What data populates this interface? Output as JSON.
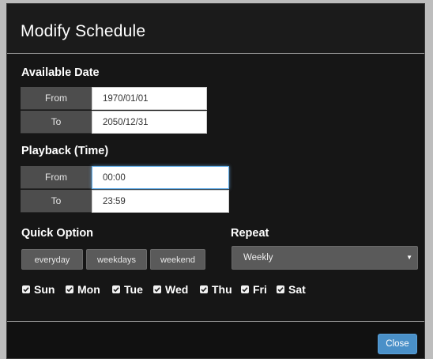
{
  "dialog": {
    "title": "Modify Schedule"
  },
  "available_date": {
    "heading": "Available Date",
    "from_label": "From",
    "from_value": "1970/01/01",
    "to_label": "To",
    "to_value": "2050/12/31"
  },
  "playback_time": {
    "heading": "Playback (Time)",
    "from_label": "From",
    "from_value": "00:00",
    "to_label": "To",
    "to_value": "23:59"
  },
  "quick_option": {
    "heading": "Quick Option",
    "buttons": [
      "everyday",
      "weekdays",
      "weekend"
    ]
  },
  "repeat": {
    "heading": "Repeat",
    "selected": "Weekly",
    "arrow": "▼"
  },
  "days": [
    {
      "label": "Sun",
      "checked": true
    },
    {
      "label": "Mon",
      "checked": true
    },
    {
      "label": "Tue",
      "checked": true
    },
    {
      "label": "Wed",
      "checked": true
    },
    {
      "label": "Thu",
      "checked": true
    },
    {
      "label": "Fri",
      "checked": true
    },
    {
      "label": "Sat",
      "checked": true
    }
  ],
  "footer": {
    "close_label": "Close"
  },
  "colors": {
    "background": "#161616",
    "label_cell": "#4d4d4d",
    "button": "#5a5a5a",
    "accent": "#4a90c8",
    "focus_ring": "#66afe9"
  }
}
